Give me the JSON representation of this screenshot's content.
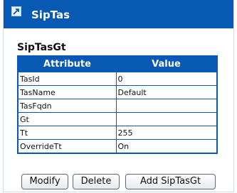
{
  "window": {
    "title": "SipTas",
    "icon": "window-icon"
  },
  "section": {
    "title": "SipTasGt"
  },
  "table": {
    "headers": [
      "Attribute",
      "Value"
    ],
    "rows": [
      {
        "attribute": "TasId",
        "value": "0"
      },
      {
        "attribute": "TasName",
        "value": "Default"
      },
      {
        "attribute": "TasFqdn",
        "value": ""
      },
      {
        "attribute": "Gt",
        "value": ""
      },
      {
        "attribute": "Tt",
        "value": "255"
      },
      {
        "attribute": "OverrideTt",
        "value": "On"
      }
    ]
  },
  "buttons": {
    "modify": "Modify",
    "delete": "Delete",
    "add": "Add SipTasGt"
  },
  "colors": {
    "accent": "#0859b4"
  }
}
